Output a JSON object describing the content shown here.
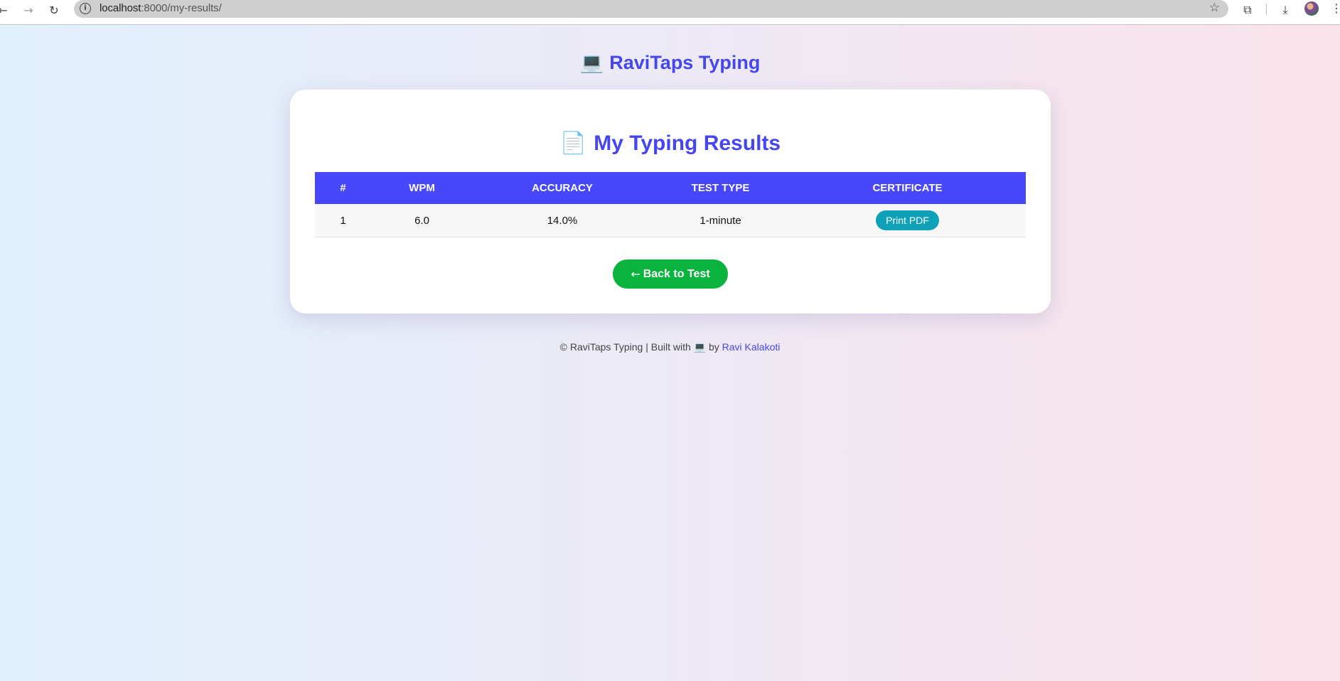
{
  "browser": {
    "url_host": "localhost",
    "url_rest": ":8000/my-results/",
    "back_icon": "arrow-left-icon",
    "forward_icon": "arrow-right-icon",
    "reload_icon": "reload-icon",
    "site_info_icon": "info-icon",
    "bookmark_icon": "star-icon",
    "extensions_icon": "puzzle-icon",
    "download_icon": "download-icon",
    "menu_icon": "kebab-icon"
  },
  "header": {
    "emoji": "💻",
    "title": "RaviTaps Typing"
  },
  "results": {
    "emoji": "📄",
    "title": "My Typing Results",
    "columns": [
      "#",
      "WPM",
      "ACCURACY",
      "TEST TYPE",
      "CERTIFICATE"
    ],
    "rows": [
      {
        "index": "1",
        "wpm": "6.0",
        "accuracy": "14.0%",
        "test_type": "1-minute",
        "certificate_label": "Print PDF"
      }
    ]
  },
  "actions": {
    "back_arrow": "←",
    "back_label": "Back to Test"
  },
  "footer": {
    "prefix": "© RaviTaps Typing | Built with",
    "emoji": "💻",
    "by": "by",
    "author": "Ravi Kalakoti"
  },
  "colors": {
    "brand": "#4646ee",
    "table_header": "#4747fb",
    "print_button": "#0fa1b8",
    "back_button": "#0ab33e"
  }
}
